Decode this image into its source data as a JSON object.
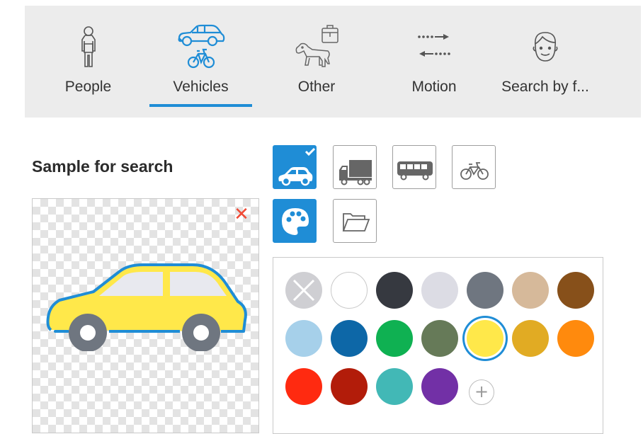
{
  "tabs": [
    {
      "id": "people",
      "label": "People",
      "icon": "person-icon",
      "active": false
    },
    {
      "id": "vehicles",
      "label": "Vehicles",
      "icon": "car-bicycle-icon",
      "active": true
    },
    {
      "id": "other",
      "label": "Other",
      "icon": "dog-luggage-icon",
      "active": false
    },
    {
      "id": "motion",
      "label": "Motion",
      "icon": "motion-arrows-icon",
      "active": false
    },
    {
      "id": "face",
      "label": "Search by f...",
      "icon": "face-icon",
      "active": false
    }
  ],
  "sample": {
    "title": "Sample for search",
    "clear_glyph": "✕",
    "image_icon": "car-icon",
    "car_color": "#ffe84a"
  },
  "vehicle_types": [
    {
      "id": "car",
      "icon": "car-icon",
      "selected": true
    },
    {
      "id": "truck",
      "icon": "truck-icon",
      "selected": false
    },
    {
      "id": "bus",
      "icon": "bus-icon",
      "selected": false
    },
    {
      "id": "bicycle",
      "icon": "bicycle-icon",
      "selected": false
    }
  ],
  "modes": [
    {
      "id": "color",
      "icon": "palette-icon",
      "active": true
    },
    {
      "id": "folder",
      "icon": "folder-icon",
      "active": false
    }
  ],
  "colors": {
    "accent": "#1f8dd6",
    "add_glyph": "+",
    "swatches": [
      {
        "name": "any",
        "hex": "#cfcfd3"
      },
      {
        "name": "white",
        "hex": "#ffffff"
      },
      {
        "name": "black",
        "hex": "#363940"
      },
      {
        "name": "light-gray",
        "hex": "#dcdce4"
      },
      {
        "name": "gray",
        "hex": "#6f7680"
      },
      {
        "name": "beige",
        "hex": "#d6b99a"
      },
      {
        "name": "brown",
        "hex": "#87501a"
      },
      {
        "name": "light-blue",
        "hex": "#a6d0ea"
      },
      {
        "name": "blue",
        "hex": "#0d67a7"
      },
      {
        "name": "green",
        "hex": "#0fb152"
      },
      {
        "name": "olive",
        "hex": "#667a58"
      },
      {
        "name": "yellow",
        "hex": "#ffe84a",
        "selected": true
      },
      {
        "name": "gold",
        "hex": "#e1ab23"
      },
      {
        "name": "orange",
        "hex": "#ff8a0d"
      },
      {
        "name": "red",
        "hex": "#ff2a10"
      },
      {
        "name": "dark-red",
        "hex": "#b21c0a"
      },
      {
        "name": "teal",
        "hex": "#42b8b6"
      },
      {
        "name": "purple",
        "hex": "#7230a6"
      }
    ]
  }
}
